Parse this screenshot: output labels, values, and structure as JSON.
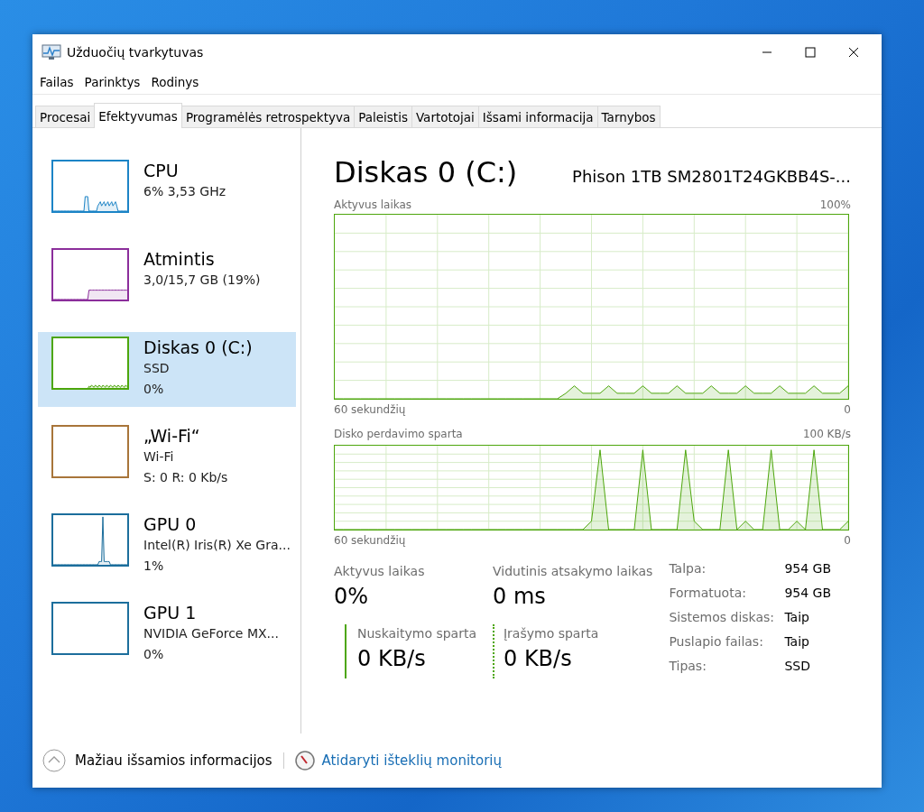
{
  "window": {
    "title": "Užduočių tvarkytuvas"
  },
  "menu": [
    "Failas",
    "Parinktys",
    "Rodinys"
  ],
  "tabs": [
    {
      "label": "Procesai",
      "selected": false
    },
    {
      "label": "Efektyvumas",
      "selected": true
    },
    {
      "label": "Programėlės retrospektyva",
      "selected": false
    },
    {
      "label": "Paleistis",
      "selected": false
    },
    {
      "label": "Vartotojai",
      "selected": false
    },
    {
      "label": "Išsami informacija",
      "selected": false
    },
    {
      "label": "Tarnybos",
      "selected": false
    }
  ],
  "sidebar": {
    "items": [
      {
        "title": "CPU",
        "lines": [
          "6% 3,53 GHz"
        ],
        "color": "#1c84c6",
        "selected": false
      },
      {
        "title": "Atmintis",
        "lines": [
          "3,0/15,7 GB (19%)"
        ],
        "color": "#8b2e9b",
        "selected": false
      },
      {
        "title": "Diskas 0 (C:)",
        "lines": [
          "SSD",
          "0%"
        ],
        "color": "#4da60c",
        "selected": true
      },
      {
        "title": "„Wi-Fi“",
        "lines": [
          "Wi-Fi",
          "S: 0 R: 0 Kb/s"
        ],
        "color": "#a8753a",
        "selected": false
      },
      {
        "title": "GPU 0",
        "lines": [
          "Intel(R) Iris(R) Xe Gra...",
          "1%"
        ],
        "color": "#1c6e9c",
        "selected": false
      },
      {
        "title": "GPU 1",
        "lines": [
          "NVIDIA GeForce MX...",
          "0%"
        ],
        "color": "#1c6e9c",
        "selected": false
      }
    ]
  },
  "header": {
    "title": "Diskas 0 (C:)",
    "model": "Phison 1TB SM2801T24GKBB4S-..."
  },
  "graphs": [
    {
      "label": "Aktyvus laikas",
      "max_label": "100%",
      "time_label": "60 sekundžių",
      "min_label": "0"
    },
    {
      "label": "Disko perdavimo sparta",
      "max_label": "100 KB/s",
      "time_label": "60 sekundžių",
      "min_label": "0"
    }
  ],
  "stats": [
    {
      "kind": "plain",
      "label": "Aktyvus laikas",
      "value": "0%"
    },
    {
      "kind": "plain",
      "label": "Vidutinis atsakymo laikas",
      "value": "0 ms"
    },
    {
      "kind": "read",
      "label": "Nuskaitymo sparta",
      "value": "0 KB/s"
    },
    {
      "kind": "write",
      "label": "Įrašymo sparta",
      "value": "0 KB/s"
    }
  ],
  "properties": [
    {
      "label": "Talpa:",
      "value": "954 GB"
    },
    {
      "label": "Formatuota:",
      "value": "954 GB"
    },
    {
      "label": "Sistemos diskas:",
      "value": "Taip"
    },
    {
      "label": "Puslapio failas:",
      "value": "Taip"
    },
    {
      "label": "Tipas:",
      "value": "SSD"
    }
  ],
  "footer": {
    "less_details": "Mažiau išsamios informacijos",
    "monitor_link": "Atidaryti išteklių monitorių"
  }
}
